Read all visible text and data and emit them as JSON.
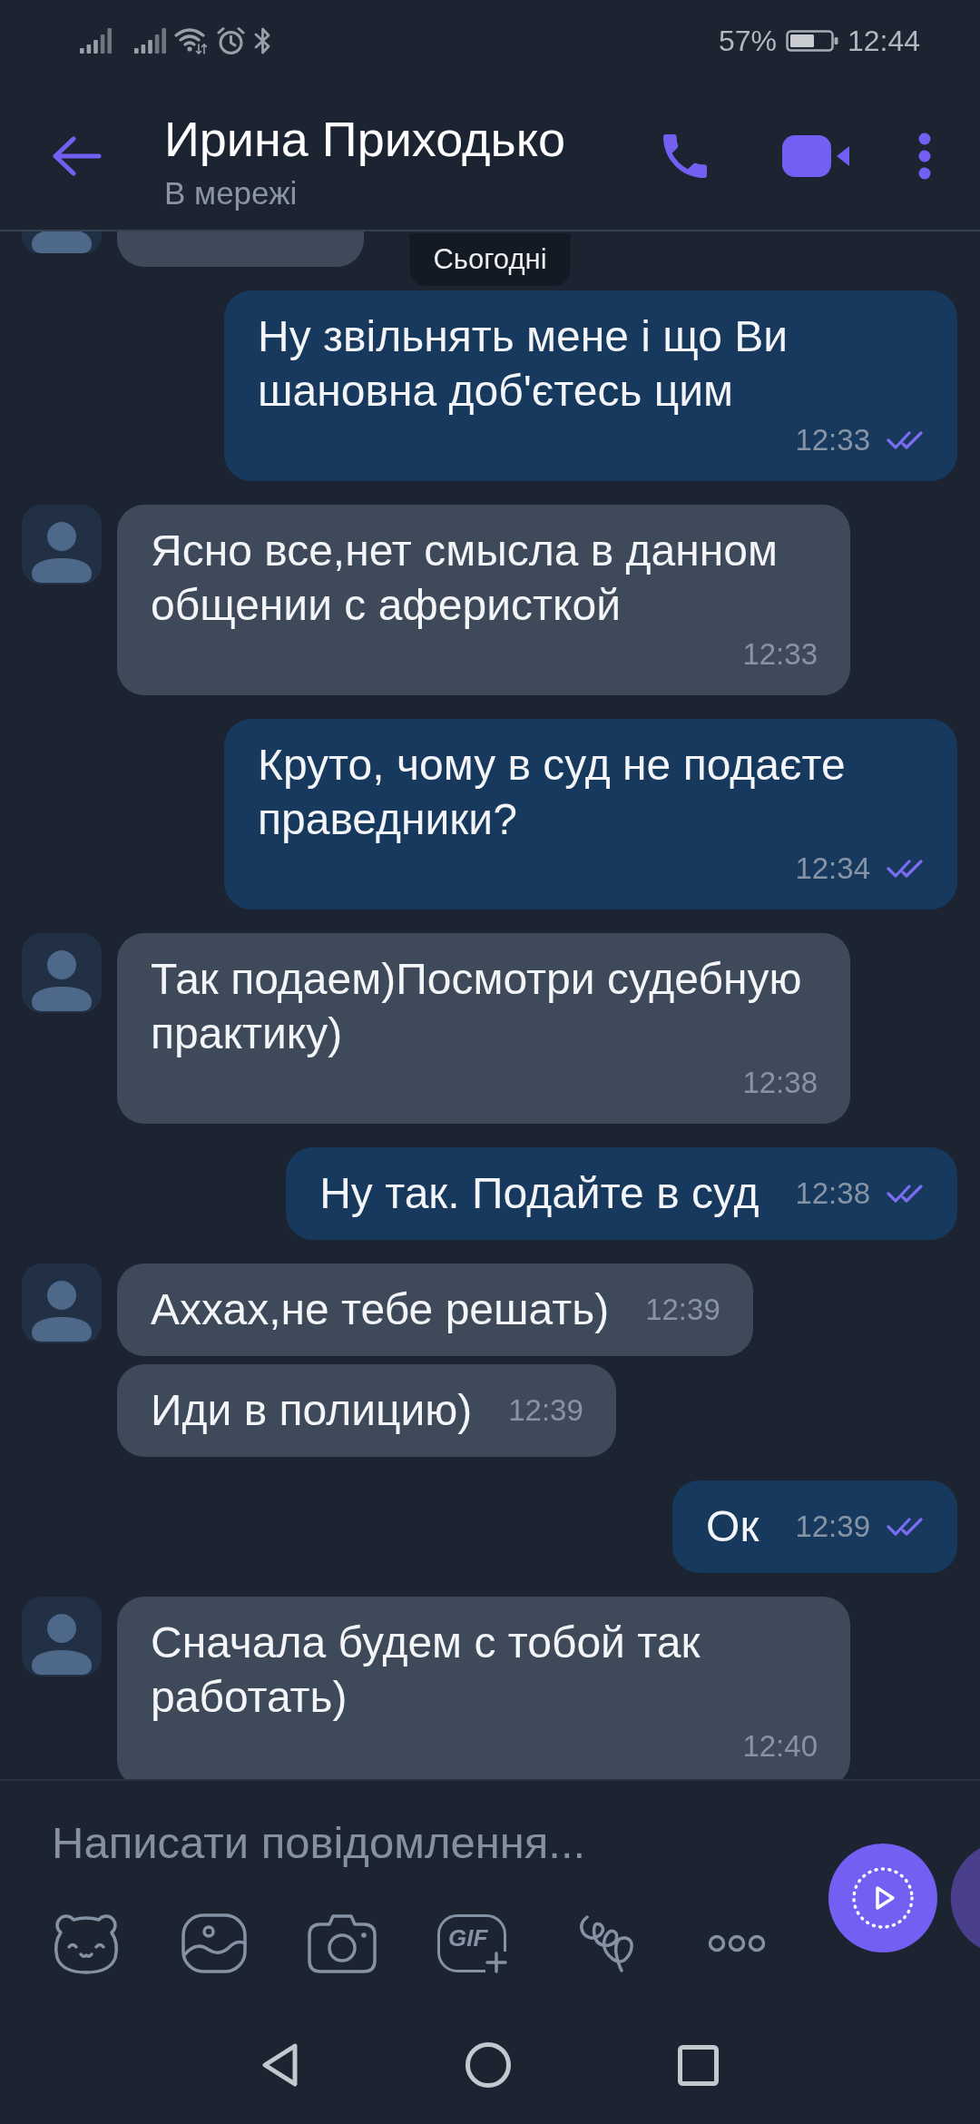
{
  "status_bar": {
    "battery_text": "57%",
    "time": "12:44"
  },
  "header": {
    "title": "Ирина Приходько",
    "subtitle": "В мережі"
  },
  "date_label": "Сьогодні",
  "messages": [
    {
      "kind": "clipped"
    },
    {
      "kind": "outgoing",
      "text": "Ну звільнять мене і що Ви шановна доб'єтесь цим",
      "time": "12:33",
      "read": true
    },
    {
      "kind": "incoming",
      "text": "Ясно все,нет смысла в данном общении с аферисткой",
      "time": "12:33",
      "avatar": true
    },
    {
      "kind": "outgoing",
      "text": "Круто, чому в суд не подаєте праведники?",
      "time": "12:34",
      "read": true
    },
    {
      "kind": "incoming",
      "text": "Так подаем)Посмотри судебную практику)",
      "time": "12:38",
      "avatar": true
    },
    {
      "kind": "outgoing",
      "text": "Ну так. Подайте в суд",
      "time": "12:38",
      "read": true
    },
    {
      "kind": "incoming",
      "text": "Аххах,не тебе решать)",
      "time": "12:39",
      "avatar": true
    },
    {
      "kind": "incoming",
      "text": "Иди в полицию)",
      "time": "12:39",
      "avatar": false
    },
    {
      "kind": "outgoing",
      "text": "Ок",
      "time": "12:39",
      "read": true
    },
    {
      "kind": "incoming",
      "text": "Сначала будем с тобой так работать)",
      "time": "12:40",
      "avatar": true
    }
  ],
  "composer": {
    "placeholder": "Написати повідомлення...",
    "gif_label": "GIF"
  }
}
